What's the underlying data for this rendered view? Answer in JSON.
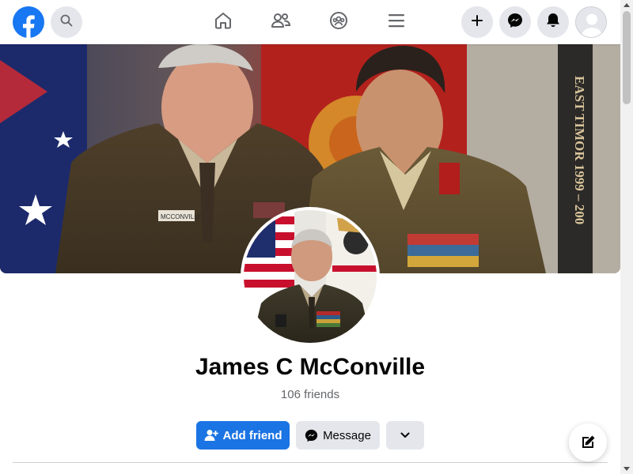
{
  "profile": {
    "name": "James C McConville",
    "friends": "106 friends"
  },
  "actions": {
    "add_friend": "Add friend",
    "message": "Message"
  },
  "cover_text": {
    "banner": "EAST TIMOR 1999 – 200",
    "nametag": "MCCONVILLE"
  },
  "colors": {
    "brand": "#1877f2",
    "primary_button": "#1b74e4",
    "secondary_button": "#e4e6eb"
  },
  "icons": {
    "logo": "facebook-logo",
    "search": "search-icon",
    "home": "home-icon",
    "friends": "friends-icon",
    "groups": "groups-icon",
    "menu": "menu-icon",
    "create": "plus-icon",
    "messenger": "messenger-icon",
    "notifications": "bell-icon",
    "compose": "compose-icon"
  }
}
